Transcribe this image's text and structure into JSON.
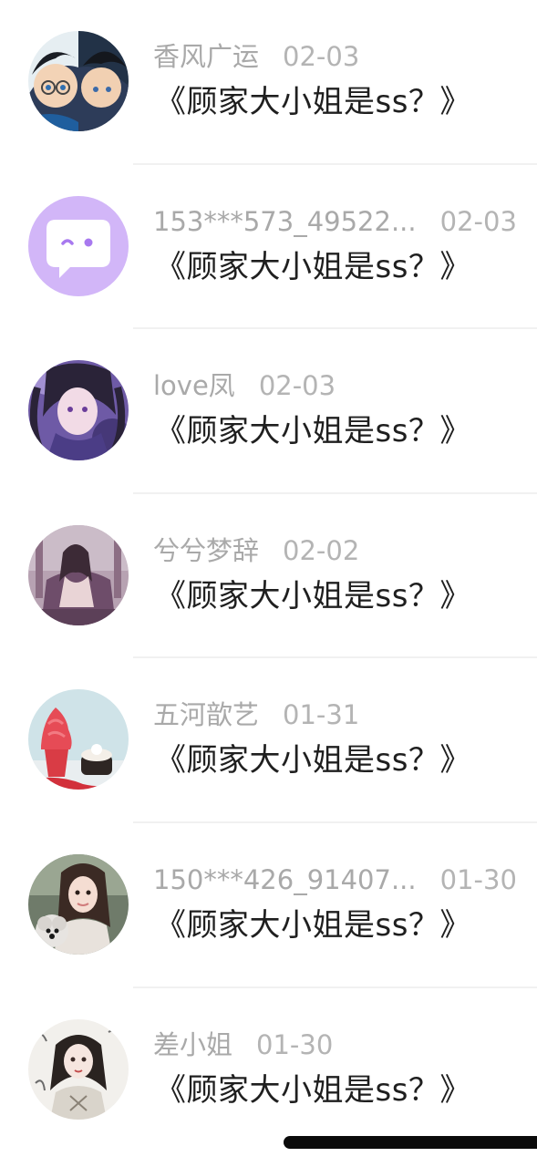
{
  "messages": [
    {
      "name": "香风广运",
      "date": "02-03",
      "content": "《顾家大小姐是ss？》",
      "avatar": "avatar-anime-detective-icon"
    },
    {
      "name": "153***573_49522...",
      "date": "02-03",
      "content": "《顾家大小姐是ss？》",
      "avatar": "avatar-default-chat-bubble-icon"
    },
    {
      "name": "love凤",
      "date": "02-03",
      "content": "《顾家大小姐是ss？》",
      "avatar": "avatar-anime-girl-purple-icon"
    },
    {
      "name": "兮兮梦辞",
      "date": "02-02",
      "content": "《顾家大小姐是ss？》",
      "avatar": "avatar-anime-girl-throne-icon"
    },
    {
      "name": "五河歆艺",
      "date": "01-31",
      "content": "《顾家大小姐是ss？》",
      "avatar": "avatar-ice-cream-icon"
    },
    {
      "name": "150***426_91407...",
      "date": "01-30",
      "content": "《顾家大小姐是ss？》",
      "avatar": "avatar-girl-with-dog-icon"
    },
    {
      "name": "差小姐",
      "date": "01-30",
      "content": "《顾家大小姐是ss？》",
      "avatar": "avatar-ink-girl-icon"
    }
  ],
  "colors": {
    "name_text": "#a9a9a9",
    "content_text": "#1f1f1f",
    "divider": "#f1f1f1",
    "default_avatar_bg": "#d2b6f8"
  }
}
